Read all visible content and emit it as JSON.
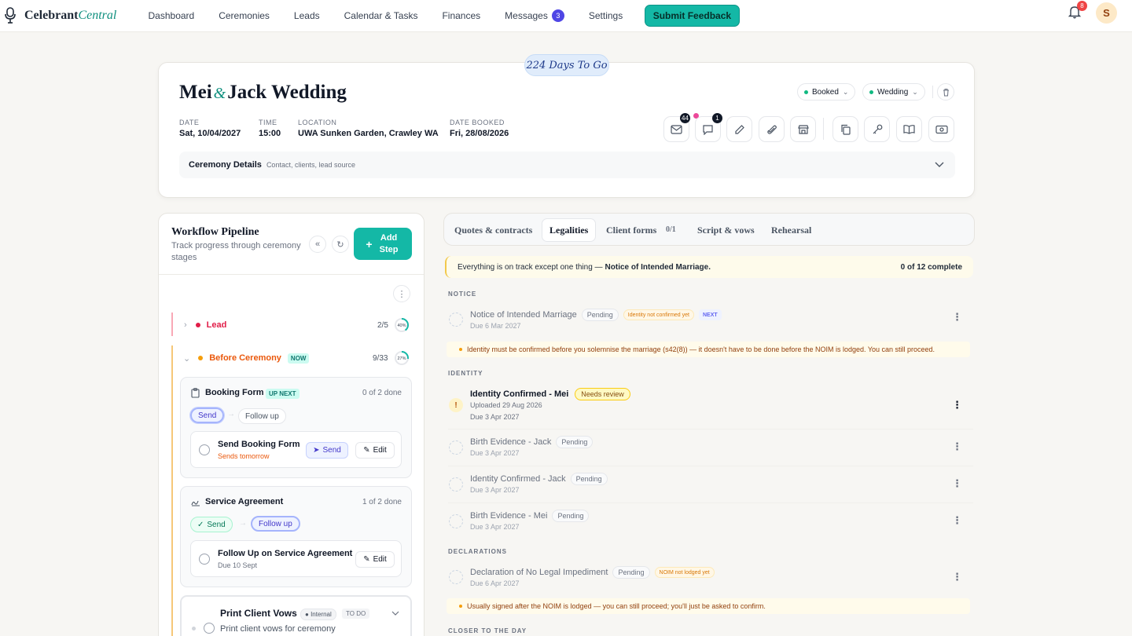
{
  "app": {
    "brand_main": "Celebrant",
    "brand_accent": "Central"
  },
  "nav": {
    "items": [
      "Dashboard",
      "Ceremonies",
      "Leads",
      "Calendar & Tasks",
      "Finances",
      "Messages",
      "Settings"
    ],
    "messages_badge": "3",
    "feedback_label": "Submit Feedback",
    "notif_badge": "8",
    "avatar_initial": "S"
  },
  "header": {
    "countdown": "224 Days To Go",
    "title_a": "Mei",
    "title_amp": "&",
    "title_b": "Jack Wedding",
    "date_label": "DATE",
    "date": "Sat, 10/04/2027",
    "time_label": "TIME",
    "time": "15:00",
    "location_label": "LOCATION",
    "location": "UWA Sunken Garden, Crawley WA",
    "booked_label": "DATE BOOKED",
    "booked": "Fri, 28/08/2026",
    "status_select": "Booked",
    "type_select": "Wedding",
    "mail_badge": "44",
    "chat_badge": "1",
    "details_label": "Ceremony Details",
    "details_sub": "Contact, clients, lead source"
  },
  "workflow": {
    "title": "Workflow Pipeline",
    "subtitle": "Track progress through ceremony stages",
    "add_step": "Add Step",
    "stages": [
      {
        "name": "Lead",
        "count": "2/5",
        "pct": "40%",
        "progress": 0.4
      },
      {
        "name": "Before Ceremony",
        "badge": "NOW",
        "count": "9/33",
        "pct": "27%",
        "progress": 0.27
      }
    ],
    "steps": [
      {
        "title": "Booking Form",
        "badge": "UP NEXT",
        "done": "0 of 2 done",
        "tag1": "Send",
        "tag2": "Follow up",
        "task": "Send Booking Form",
        "task_sub": "Sends tomorrow",
        "btn_send": "Send",
        "btn_edit": "Edit"
      },
      {
        "title": "Service Agreement",
        "done": "1 of 2 done",
        "tag1": "Send",
        "tag2": "Follow up",
        "task": "Follow Up on Service Agreement",
        "task_sub": "Due 10 Sept",
        "btn_edit": "Edit"
      },
      {
        "title": "Print Client Vows",
        "badge1": "Internal",
        "badge2": "TO DO",
        "task": "Print client vows for ceremony"
      }
    ]
  },
  "tabs": {
    "items": [
      "Quotes & contracts",
      "Legalities",
      "Client forms",
      "Script & vows",
      "Rehearsal"
    ],
    "client_forms_count": "0/1",
    "active": "Legalities"
  },
  "legalities": {
    "banner_text": "Everything is on track except one thing — ",
    "banner_bold": "Notice of Intended Marriage.",
    "banner_count": "0 of 12 complete",
    "sections": [
      "NOTICE",
      "IDENTITY",
      "DECLARATIONS",
      "CLOSER TO THE DAY"
    ],
    "noim": {
      "title": "Notice of Intended Marriage",
      "status": "Pending",
      "warn": "Identity not confirmed yet",
      "next": "NEXT",
      "due": "Due 6 Mar 2027",
      "note": "Identity must be confirmed before you solemnise the marriage (s42(8)) — it doesn't have to be done before the NOIM is lodged. You can still proceed."
    },
    "identity": [
      {
        "title": "Identity Confirmed - Mei",
        "status": "Needs review",
        "sub1": "Uploaded 29 Aug 2026",
        "sub2": "Due 3 Apr 2027"
      },
      {
        "title": "Birth Evidence - Jack",
        "status": "Pending",
        "sub1": "Due 3 Apr 2027"
      },
      {
        "title": "Identity Confirmed - Jack",
        "status": "Pending",
        "sub1": "Due 3 Apr 2027"
      },
      {
        "title": "Birth Evidence - Mei",
        "status": "Pending",
        "sub1": "Due 3 Apr 2027"
      }
    ],
    "declaration": {
      "title": "Declaration of No Legal Impediment",
      "status": "Pending",
      "warn": "NOIM not lodged yet",
      "due": "Due 6 Apr 2027",
      "note": "Usually signed after the NOIM is lodged — you can still proceed; you'll just be asked to confirm."
    }
  },
  "colors": {
    "accent": "#14b8a6",
    "lead": "#e11d48",
    "before": "#ea580c",
    "badge": "#4f46e5"
  }
}
